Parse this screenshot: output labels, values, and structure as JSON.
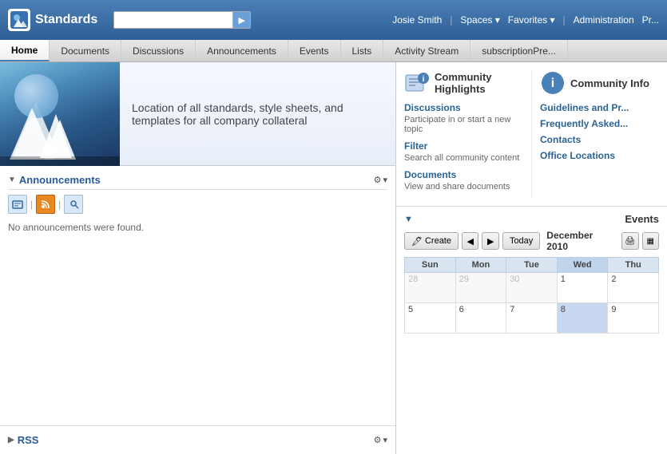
{
  "topbar": {
    "logo_text": "Standards",
    "search_placeholder": "",
    "search_btn_label": "▶",
    "user_name": "Josie Smith",
    "spaces_label": "Spaces ▾",
    "favorites_label": "Favorites ▾",
    "administration_label": "Administration",
    "more_label": "Pr..."
  },
  "navbar": {
    "items": [
      {
        "label": "Home",
        "active": true
      },
      {
        "label": "Documents",
        "active": false
      },
      {
        "label": "Discussions",
        "active": false
      },
      {
        "label": "Announcements",
        "active": false
      },
      {
        "label": "Events",
        "active": false
      },
      {
        "label": "Lists",
        "active": false
      },
      {
        "label": "Activity Stream",
        "active": false
      },
      {
        "label": "subscriptionPre...",
        "active": false
      }
    ]
  },
  "banner": {
    "text": "Location of all standards, style sheets, and templates for all company collateral"
  },
  "announcements": {
    "title": "Announcements",
    "no_announcements": "No announcements were found.",
    "icon1": "📋",
    "icon2": "📰",
    "icon3": "🔍"
  },
  "rss": {
    "title": "RSS"
  },
  "community_highlights": {
    "title": "Community Highlights",
    "discussions": {
      "label": "Discussions",
      "desc": "Participate in or start a new topic"
    },
    "filter": {
      "label": "Filter",
      "desc": "Search all community content"
    },
    "documents": {
      "label": "Documents",
      "desc": "View and share documents"
    }
  },
  "community_info": {
    "title": "Community Info",
    "links": [
      "Guidelines and Pr...",
      "Frequently Asked...",
      "Contacts",
      "Office Locations"
    ]
  },
  "events": {
    "title": "Events",
    "create_label": "Create",
    "today_label": "Today",
    "month": "December 2010",
    "days_of_week": [
      "Sun",
      "Mon",
      "Tue",
      "Wed",
      "Thu"
    ],
    "weeks": [
      [
        {
          "num": "28",
          "other": true
        },
        {
          "num": "29",
          "other": true
        },
        {
          "num": "30",
          "other": true
        },
        {
          "num": "1",
          "today": false
        },
        {
          "num": "2",
          "today": false
        }
      ],
      [
        {
          "num": "5",
          "today": false
        },
        {
          "num": "6",
          "today": false
        },
        {
          "num": "7",
          "today": false
        },
        {
          "num": "8",
          "today": true
        },
        {
          "num": "9",
          "today": false
        }
      ]
    ]
  }
}
